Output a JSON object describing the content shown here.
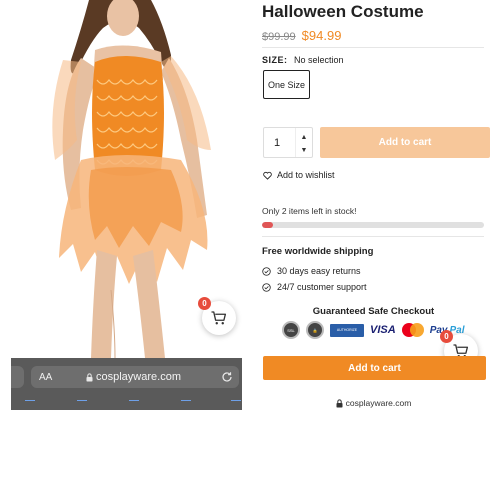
{
  "browser": {
    "text_size_label": "AA",
    "url": "cosplayware.com"
  },
  "product": {
    "title": "Halloween Costume",
    "old_price": "$99.99",
    "new_price": "$94.99"
  },
  "size": {
    "label": "SIZE:",
    "selection": "No selection",
    "options": [
      "One Size"
    ]
  },
  "cart": {
    "quantity": "1",
    "add_to_cart_label": "Add to cart",
    "count": "0"
  },
  "wishlist": {
    "label": "Add to wishlist"
  },
  "stock": {
    "text": "Only 2 items left in stock!",
    "level": 0.05
  },
  "shipping": {
    "heading": "Free worldwide shipping",
    "perks": [
      "30 days easy returns",
      "24/7 customer support"
    ]
  },
  "checkout": {
    "heading": "Guaranteed Safe Checkout",
    "badges": [
      "VISA",
      "Pay",
      "Pal"
    ]
  },
  "footer": {
    "url": "cosplayware.com"
  },
  "colors": {
    "accent": "#f08a24",
    "accent_disabled": "#f7c79a",
    "stock_bar": "#e05656",
    "browser_bar": "#5a5a5a"
  }
}
